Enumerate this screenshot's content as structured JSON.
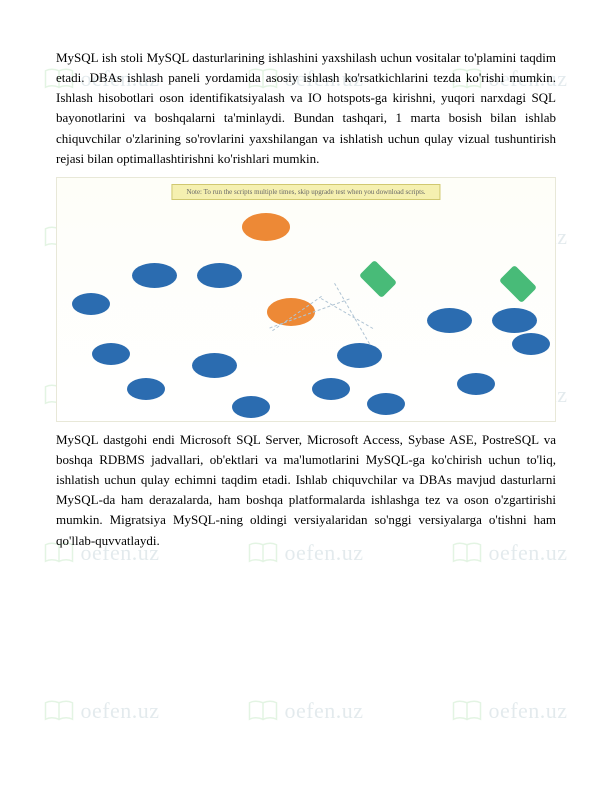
{
  "watermark": {
    "text": "oefen.uz"
  },
  "paragraph1": "MySQL ish stoli MySQL dasturlarining ishlashini yaxshilash uchun vositalar to'plamini taqdim etadi. DBAs ishlash paneli yordamida asosiy ishlash ko'rsatkichlarini tezda ko'rishi mumkin. Ishlash hisobotlari oson identifikatsiyalash va IO hotspots-ga kirishni, yuqori narxdagi SQL bayonotlarini va boshqalarni ta'minlaydi. Bundan tashqari, 1 marta bosish bilan ishlab chiquvchilar o'zlarining so'rovlarini yaxshilangan va ishlatish uchun qulay vizual tushuntirish rejasi bilan optimallashtirishni ko'rishlari mumkin.",
  "paragraph2": "MySQL dastgohi endi Microsoft SQL Server, Microsoft Access, Sybase ASE, PostreSQL va boshqa RDBMS jadvallari, ob'ektlari va ma'lumotlarini MySQL-ga ko'chirish uchun to'liq, ishlatish uchun qulay echimni taqdim etadi. Ishlab chiquvchilar va DBAs mavjud dasturlarni MySQL-da ham derazalarda, ham boshqa platformalarda ishlashga tez va oson o'zgartirishi mumkin. Migratsiya MySQL-ning oldingi versiyalaridan so'nggi versiyalarga o'tishni ham qo'llab-quvvatlaydi.",
  "diagram": {
    "title": "Note: To run the scripts multiple times, skip upgrade test when you download scripts."
  }
}
